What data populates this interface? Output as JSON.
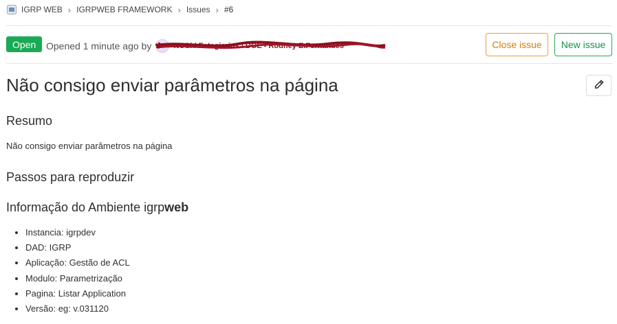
{
  "breadcrumb": {
    "group": "IGRP WEB",
    "project": "IGRPWEB FRAMEWORK",
    "section": "Issues",
    "issue": "#6"
  },
  "header": {
    "status": "Open",
    "opened_text": "Opened 1 minute ago by",
    "author": "NOSi / Estagiarios / DGE - Rodney E.Fernandes",
    "close_label": "Close issue",
    "new_label": "New issue"
  },
  "issue": {
    "title": "Não consigo enviar parâmetros na página",
    "sections": {
      "resumo": "Resumo",
      "resumo_text": "Não consigo enviar parâmetros na página",
      "passos": "Passos para reproduzir",
      "ambiente_prefix": "Informação do Ambiente igrp",
      "ambiente_bold": "web"
    },
    "env": [
      "Instancia: igrpdev",
      "DAD: IGRP",
      "Aplicação: Gestão de ACL",
      "Modulo: Parametrização",
      "Pagina: Listar Application",
      "Versão: eg: v.031120"
    ]
  },
  "icons": {
    "edit": "pencil-icon",
    "project": "project-avatar-icon"
  },
  "colors": {
    "open": "#1aaa55",
    "close_border": "#e1a33b",
    "new_border": "#1aaa55"
  }
}
